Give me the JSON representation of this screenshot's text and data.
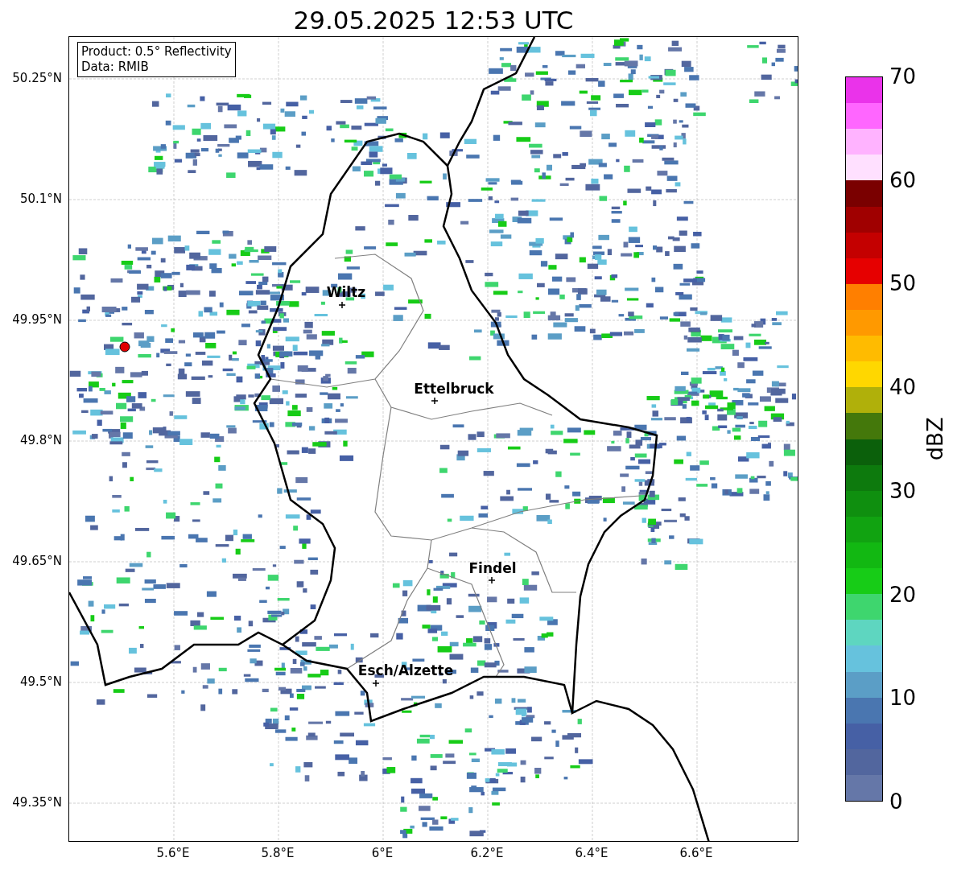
{
  "title": "29.05.2025 12:53 UTC",
  "info_box": [
    "Product: 0.5° Reflectivity",
    "Data: RMIB"
  ],
  "y_ticks": [
    "50.25°N",
    "50.1°N",
    "49.95°N",
    "49.8°N",
    "49.65°N",
    "49.5°N",
    "49.35°N"
  ],
  "x_ticks": [
    "5.6°E",
    "5.8°E",
    "6°E",
    "6.2°E",
    "6.4°E",
    "6.6°E"
  ],
  "cities": [
    {
      "name": "Wiltz"
    },
    {
      "name": "Ettelbruck"
    },
    {
      "name": "Findel"
    },
    {
      "name": "Esch/Alzette"
    }
  ],
  "colorbar": {
    "label": "dBZ",
    "ticks": [
      "70",
      "60",
      "50",
      "40",
      "30",
      "20",
      "10",
      "0"
    ],
    "bins": [
      {
        "color": "#ea33ea"
      },
      {
        "color": "#ff66ff"
      },
      {
        "color": "#ffb3ff"
      },
      {
        "color": "#ffe0ff"
      },
      {
        "color": "#7a0000"
      },
      {
        "color": "#a00000"
      },
      {
        "color": "#c40000"
      },
      {
        "color": "#e60000"
      },
      {
        "color": "#ff7f00"
      },
      {
        "color": "#ff9900"
      },
      {
        "color": "#ffbb00"
      },
      {
        "color": "#ffd700"
      },
      {
        "color": "#b0b00a"
      },
      {
        "color": "#44780b"
      },
      {
        "color": "#0b600b"
      },
      {
        "color": "#0d7a0d"
      },
      {
        "color": "#0f8f0f"
      },
      {
        "color": "#11a311"
      },
      {
        "color": "#12b812"
      },
      {
        "color": "#17cc17"
      },
      {
        "color": "#3ed66e"
      },
      {
        "color": "#5ed6c0"
      },
      {
        "color": "#66c2dd"
      },
      {
        "color": "#5b9ec6"
      },
      {
        "color": "#4a76b0"
      },
      {
        "color": "#4660a5"
      },
      {
        "color": "#52669e"
      },
      {
        "color": "#6577a8"
      }
    ]
  }
}
